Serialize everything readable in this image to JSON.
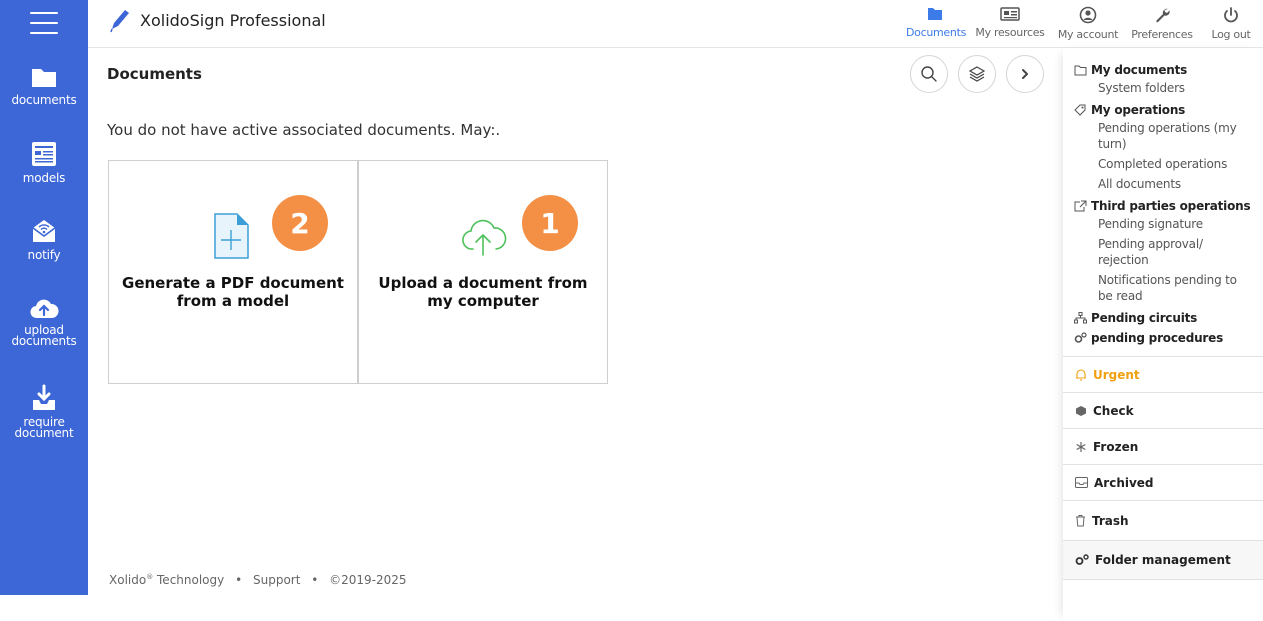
{
  "app": {
    "title": "XolidoSign Professional"
  },
  "topnav": [
    {
      "label": "Documents",
      "icon": "folder-icon"
    },
    {
      "label": "My resources",
      "icon": "id-card-icon"
    },
    {
      "label": "My account",
      "icon": "user-icon"
    },
    {
      "label": "Preferences",
      "icon": "wrench-icon"
    },
    {
      "label": "Log out",
      "icon": "power-icon"
    }
  ],
  "sidebar": {
    "items": [
      {
        "label": "documents",
        "icon": "folder-icon"
      },
      {
        "label": "models",
        "icon": "model-icon"
      },
      {
        "label": "notify",
        "icon": "notify-envelope-icon"
      },
      {
        "label": "upload documents",
        "icon": "cloud-upload-icon"
      },
      {
        "label": "require document",
        "icon": "download-tray-icon"
      }
    ]
  },
  "main": {
    "page_title": "Documents",
    "message": "You do not have active associated documents. May:.",
    "cards": [
      {
        "label": "Generate a PDF document from a model",
        "badge": "2",
        "icon": "new-document-icon"
      },
      {
        "label": "Upload a document from my computer",
        "badge": "1",
        "icon": "cloud-upload-icon"
      }
    ]
  },
  "footer": {
    "company": "Xolido",
    "reg": "®",
    "company_suffix": " Technology",
    "separator": "•",
    "support": "Support",
    "copyright": "©2019-2025"
  },
  "right_panel": {
    "my_documents": "My documents",
    "system_folders": "System folders",
    "my_operations": "My operations",
    "pending_my_turn": "Pending operations (my turn)",
    "completed_operations": "Completed operations",
    "all_documents": "All documents",
    "third_parties": "Third parties operations",
    "pending_signature": "Pending signature",
    "pending_approval": "Pending approval/ rejection",
    "notifications_pending": "Notifications pending to be read",
    "pending_circuits": "Pending circuits",
    "pending_procedures": "pending procedures",
    "urgent": "Urgent",
    "check": "Check",
    "frozen": "Frozen",
    "archived": "Archived",
    "trash": "Trash",
    "folder_management": "Folder management"
  },
  "colors": {
    "sidebar": "#3d66d6",
    "accent": "#3d7be8",
    "badge": "#f39045",
    "urgent": "#f0a010"
  }
}
